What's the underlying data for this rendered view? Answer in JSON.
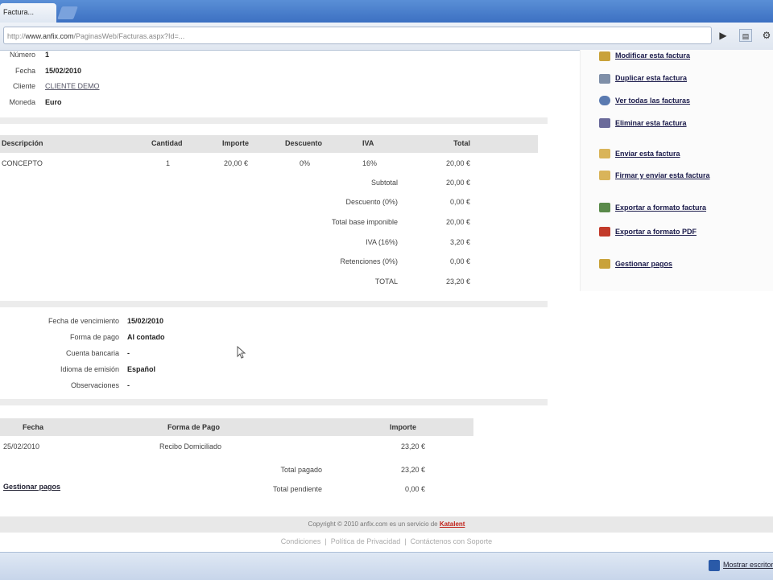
{
  "browser": {
    "tab_title": "Factura...",
    "url_domain": "www.anfix.com",
    "url_path": "/PaginasWeb/Facturas.aspx?Id=...",
    "url_prefix": "http://"
  },
  "invoice_header": {
    "numero_label": "Número",
    "numero_value": "1",
    "fecha_label": "Fecha",
    "fecha_value": "15/02/2010",
    "cliente_label": "Cliente",
    "cliente_value": "CLIENTE DEMO",
    "moneda_label": "Moneda",
    "moneda_value": "Euro"
  },
  "lines_table": {
    "headers": [
      "Descripción",
      "Cantidad",
      "Importe",
      "Descuento",
      "IVA",
      "Total"
    ],
    "rows": [
      [
        "CONCEPTO",
        "1",
        "20,00 €",
        "0%",
        "16%",
        "20,00 €"
      ]
    ]
  },
  "totals": [
    {
      "label": "Subtotal",
      "value": "20,00 €"
    },
    {
      "label": "Descuento (0%)",
      "value": "0,00 €"
    },
    {
      "label": "Total base imponible",
      "value": "20,00 €"
    },
    {
      "label": "IVA (16%)",
      "value": "3,20 €"
    },
    {
      "label": "Retenciones (0%)",
      "value": "0,00 €"
    },
    {
      "label": "TOTAL",
      "value": "23,20 €"
    }
  ],
  "payment_info": [
    {
      "label": "Fecha de vencimiento",
      "value": "15/02/2010"
    },
    {
      "label": "Forma de pago",
      "value": "Al contado"
    },
    {
      "label": "Cuenta bancaria",
      "value": "-"
    },
    {
      "label": "Idioma de emisión",
      "value": "Español"
    },
    {
      "label": "Observaciones",
      "value": "-"
    }
  ],
  "payments_table": {
    "headers": [
      "Fecha",
      "Forma de Pago",
      "Importe"
    ],
    "rows": [
      [
        "25/02/2010",
        "Recibo Domiciliado",
        "23,20 €"
      ]
    ],
    "total_pagado_label": "Total pagado",
    "total_pagado_value": "23,20 €",
    "total_pendiente_label": "Total pendiente",
    "total_pendiente_value": "0,00 €",
    "gestionar_link": "Gestionar pagos"
  },
  "actions": [
    {
      "label": "Modificar esta factura",
      "icon": "pencil-icon",
      "color": "#c9a23a"
    },
    {
      "label": "Duplicar esta factura",
      "icon": "duplicate-icon",
      "color": "#7f8fa8"
    },
    {
      "label": "Ver todas las facturas",
      "icon": "search-icon",
      "color": "#5a7ab0"
    },
    {
      "label": "Eliminar esta factura",
      "icon": "trash-icon",
      "color": "#6a6a9a"
    },
    {
      "label": "Enviar esta factura",
      "icon": "envelope-icon",
      "color": "#d9b45a"
    },
    {
      "label": "Firmar y enviar esta factura",
      "icon": "signed-envelope-icon",
      "color": "#d9b45a"
    },
    {
      "label": "Exportar a formato factura",
      "icon": "export-icon",
      "color": "#5a8a4a"
    },
    {
      "label": "Exportar a formato PDF",
      "icon": "pdf-icon",
      "color": "#c23a2a"
    },
    {
      "label": "Gestionar pagos",
      "icon": "payments-icon",
      "color": "#c9a23a"
    }
  ],
  "footer": {
    "copyright": "Copyright © 2010 anfix.com es un servicio de",
    "brand": "Katalent",
    "links": [
      "Condiciones",
      "Política de Privacidad",
      "Contáctenos con Soporte"
    ],
    "separator": "|"
  },
  "taskbar": {
    "button_label": "Mostrar escritorio"
  },
  "colors": {
    "brand_red": "#c0221a",
    "chrome_blue": "#3c70c2"
  }
}
